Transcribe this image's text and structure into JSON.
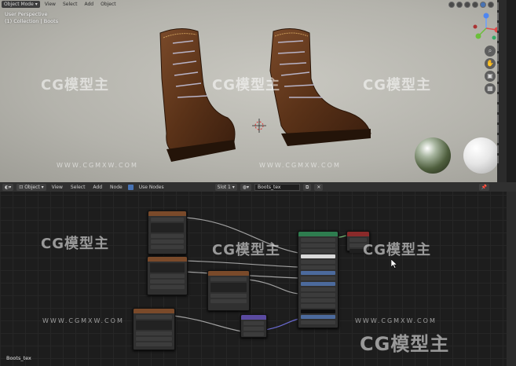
{
  "viewport": {
    "mode": "Object Mode",
    "menu": [
      "View",
      "Select",
      "Add",
      "Object"
    ],
    "overlay_line1": "User Perspective",
    "overlay_line2": "(1) Collection | Boots"
  },
  "node_editor": {
    "editor_type": "Object",
    "menu": [
      "View",
      "Select",
      "Add",
      "Node"
    ],
    "use_nodes_label": "Use Nodes",
    "slot": "Slot 1",
    "material_name": "Boots_tex",
    "footer": "Boots_tex"
  },
  "watermark": {
    "text": "CG模型主",
    "url": "WWW.CGMXW.COM"
  },
  "colors": {
    "header_dark": "#303030",
    "accent_blue": "#4772b3",
    "image_node": "#7a4a2a",
    "bsdf_node": "#2e7d4f",
    "output_node": "#8a2a2a",
    "normal_map_node": "#5a4aa0"
  },
  "icons": [
    "editor-type-icon",
    "material-icon",
    "gizmo-axes-icon",
    "zoom-icon",
    "pan-icon",
    "camera-icon",
    "grid-icon",
    "pin-icon"
  ]
}
